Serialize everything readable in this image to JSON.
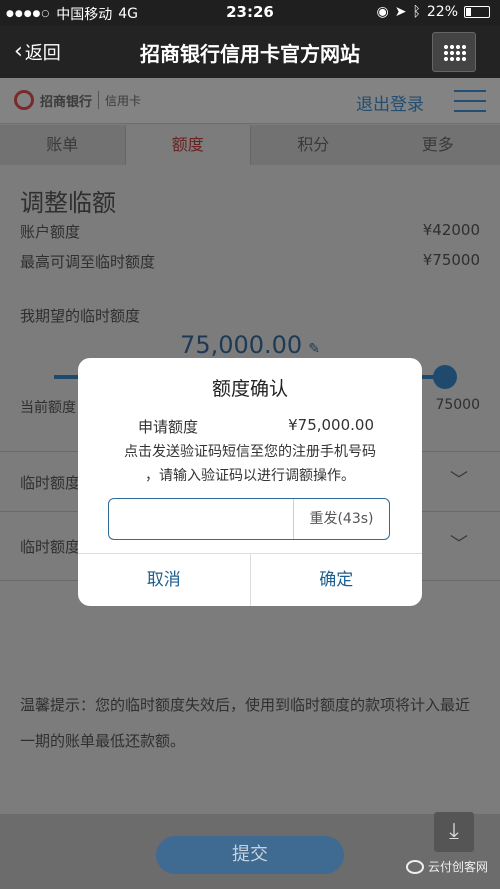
{
  "status_bar": {
    "carrier": "中国移动",
    "network": "4G",
    "time": "23:26",
    "battery": "22%"
  },
  "nav": {
    "back_label": "返回",
    "title": "招商银行信用卡官方网站"
  },
  "header": {
    "logo_text": "招商银行",
    "logo_card": "信用卡",
    "logout_label": "退出登录"
  },
  "tabs": [
    {
      "label": "账单"
    },
    {
      "label": "额度"
    },
    {
      "label": "积分"
    },
    {
      "label": "更多"
    }
  ],
  "content": {
    "heading": "调整临额",
    "account_limit_label": "账户额度",
    "account_limit_value": "¥42000",
    "max_temp_label": "最高可调至临时额度",
    "max_temp_value": "¥75000",
    "expect_label": "我期望的临时额度",
    "expect_amount": "75,000.00",
    "range_left": "当前额度",
    "range_right": "75000",
    "slider_level": 1.0,
    "field1_label": "临时额度",
    "field2_label": "临时额度",
    "tip": "温馨提示：您的临时额度失效后，使用到临时额度的款项将计入最近一期的账单最低还款额。",
    "submit_label": "提交"
  },
  "dialog": {
    "title": "额度确认",
    "amount_label": "申请额度",
    "amount_value": "¥75,000.00",
    "message_line1": "点击发送验证码短信至您的注册手机号码",
    "message_line2": "，请输入验证码以进行调额操作。",
    "code_value": "",
    "resend_label": "重发(43s)",
    "cancel_label": "取消",
    "confirm_label": "确定"
  },
  "watermark": "云付创客网",
  "colors": {
    "accent": "#1e5f8f",
    "active_tab": "#6b2222"
  }
}
